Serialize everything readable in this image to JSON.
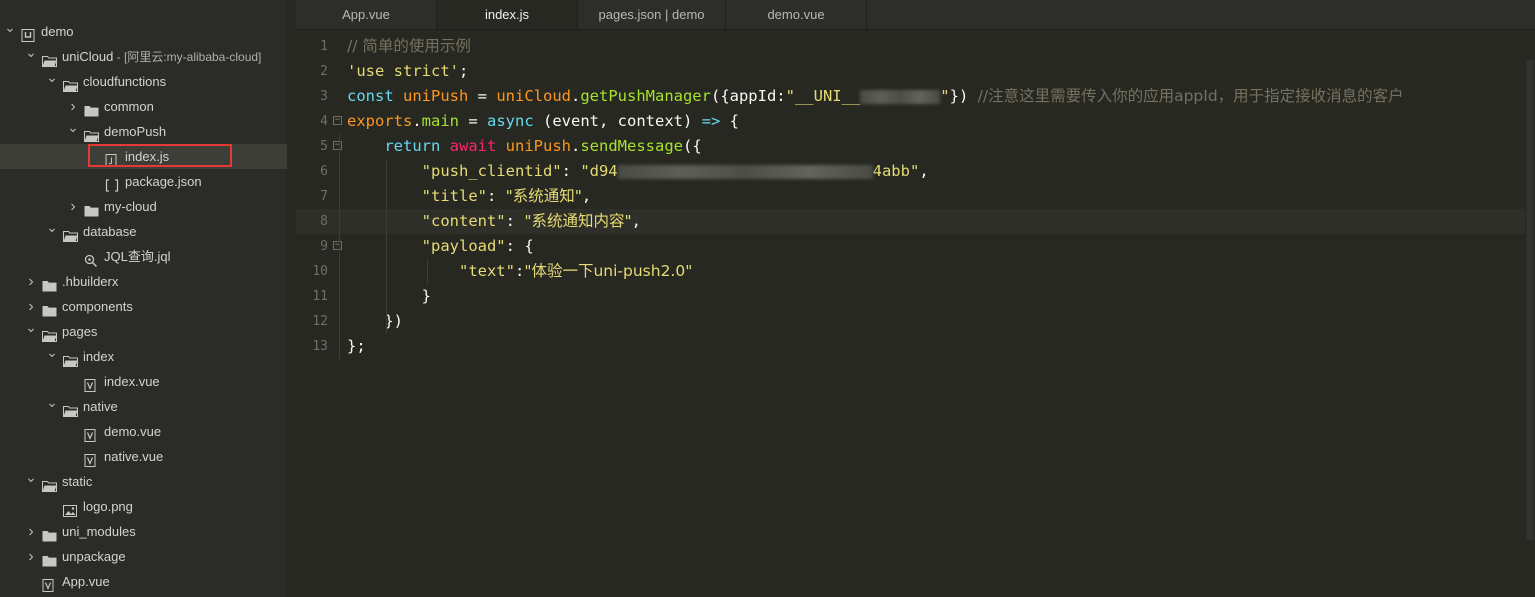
{
  "explorer": {
    "items": [
      {
        "label": "demo",
        "depth": 0,
        "chevron": "down",
        "icon": "project-icon"
      },
      {
        "label": "uniCloud",
        "suffix": " - [阿里云:my-alibaba-cloud]",
        "depth": 1,
        "chevron": "down",
        "icon": "folder-open-icon"
      },
      {
        "label": "cloudfunctions",
        "depth": 2,
        "chevron": "down",
        "icon": "folder-open-icon"
      },
      {
        "label": "common",
        "depth": 3,
        "chevron": "right",
        "icon": "folder-icon"
      },
      {
        "label": "demoPush",
        "depth": 3,
        "chevron": "down",
        "icon": "folder-open-icon"
      },
      {
        "label": "index.js",
        "depth": 4,
        "chevron": "",
        "icon": "js-file-icon",
        "selected": true
      },
      {
        "label": "package.json",
        "depth": 4,
        "chevron": "",
        "icon": "json-file-icon"
      },
      {
        "label": "my-cloud",
        "depth": 3,
        "chevron": "right",
        "icon": "folder-icon"
      },
      {
        "label": "database",
        "depth": 2,
        "chevron": "down",
        "icon": "folder-open-icon"
      },
      {
        "label": "JQL查询.jql",
        "depth": 3,
        "chevron": "",
        "icon": "jql-file-icon"
      },
      {
        "label": ".hbuilderx",
        "depth": 1,
        "chevron": "right",
        "icon": "folder-icon"
      },
      {
        "label": "components",
        "depth": 1,
        "chevron": "right",
        "icon": "folder-icon"
      },
      {
        "label": "pages",
        "depth": 1,
        "chevron": "down",
        "icon": "folder-open-icon"
      },
      {
        "label": "index",
        "depth": 2,
        "chevron": "down",
        "icon": "folder-open-icon"
      },
      {
        "label": "index.vue",
        "depth": 3,
        "chevron": "",
        "icon": "vue-file-icon"
      },
      {
        "label": "native",
        "depth": 2,
        "chevron": "down",
        "icon": "folder-open-icon"
      },
      {
        "label": "demo.vue",
        "depth": 3,
        "chevron": "",
        "icon": "vue-file-icon"
      },
      {
        "label": "native.vue",
        "depth": 3,
        "chevron": "",
        "icon": "vue-file-icon"
      },
      {
        "label": "static",
        "depth": 1,
        "chevron": "down",
        "icon": "folder-open-icon"
      },
      {
        "label": "logo.png",
        "depth": 2,
        "chevron": "",
        "icon": "image-file-icon"
      },
      {
        "label": "uni_modules",
        "depth": 1,
        "chevron": "right",
        "icon": "folder-icon"
      },
      {
        "label": "unpackage",
        "depth": 1,
        "chevron": "right",
        "icon": "folder-icon"
      },
      {
        "label": "App.vue",
        "depth": 1,
        "chevron": "",
        "icon": "vue-file-icon"
      }
    ]
  },
  "tabs": [
    {
      "label": "App.vue",
      "active": false
    },
    {
      "label": "index.js",
      "active": true
    },
    {
      "label": "pages.json | demo",
      "active": false
    },
    {
      "label": "demo.vue",
      "active": false
    }
  ],
  "editor": {
    "current_line": 8,
    "lines": [
      {
        "num": "1",
        "fold": false,
        "tokens": [
          [
            "c-comment c-zh",
            "// 简单的使用示例"
          ]
        ]
      },
      {
        "num": "2",
        "fold": false,
        "tokens": [
          [
            "c-str",
            "'use strict'"
          ],
          [
            "c-plain",
            ";"
          ]
        ]
      },
      {
        "num": "3",
        "fold": false,
        "tokens": [
          [
            "c-kw",
            "const "
          ],
          [
            "c-var",
            "uniPush"
          ],
          [
            "c-plain",
            " = "
          ],
          [
            "c-var",
            "uniCloud"
          ],
          [
            "c-plain",
            "."
          ],
          [
            "c-fn",
            "getPushManager"
          ],
          [
            "c-plain",
            "({appId:"
          ],
          [
            "c-str",
            "\"__UNI__"
          ],
          [
            "blur",
            "80"
          ],
          [
            "c-str",
            "\""
          ],
          [
            "c-plain",
            "}) "
          ],
          [
            "c-comment c-zh",
            "//注意这里需要传入你的应用appId，用于指定接收消息的客户"
          ]
        ]
      },
      {
        "num": "4",
        "fold": true,
        "tokens": [
          [
            "c-var",
            "exports"
          ],
          [
            "c-plain",
            "."
          ],
          [
            "c-fn",
            "main"
          ],
          [
            "c-plain",
            " = "
          ],
          [
            "c-kw",
            "async"
          ],
          [
            "c-plain",
            " (event, context) "
          ],
          [
            "c-kw",
            "=>"
          ],
          [
            "c-plain",
            " {"
          ]
        ]
      },
      {
        "num": "5",
        "fold": true,
        "tokens": [
          [
            "c-plain",
            "    "
          ],
          [
            "c-kw",
            "return "
          ],
          [
            "c-op",
            "await "
          ],
          [
            "c-var",
            "uniPush"
          ],
          [
            "c-plain",
            "."
          ],
          [
            "c-fn",
            "sendMessage"
          ],
          [
            "c-plain",
            "({"
          ]
        ]
      },
      {
        "num": "6",
        "fold": false,
        "tokens": [
          [
            "c-plain",
            "        "
          ],
          [
            "c-str",
            "\"push_clientid\""
          ],
          [
            "c-plain",
            ": "
          ],
          [
            "c-str",
            "\"d94"
          ],
          [
            "blur",
            "255"
          ],
          [
            "c-str",
            "4abb\""
          ],
          [
            "c-plain",
            ","
          ]
        ]
      },
      {
        "num": "7",
        "fold": false,
        "tokens": [
          [
            "c-plain",
            "        "
          ],
          [
            "c-str",
            "\"title\""
          ],
          [
            "c-plain",
            ": "
          ],
          [
            "c-str c-zh",
            "\"系统通知\""
          ],
          [
            "c-plain",
            ","
          ]
        ]
      },
      {
        "num": "8",
        "fold": false,
        "tokens": [
          [
            "c-plain",
            "        "
          ],
          [
            "c-str",
            "\"content\""
          ],
          [
            "c-plain",
            ": "
          ],
          [
            "c-str c-zh",
            "\"系统通知内容\""
          ],
          [
            "c-plain",
            ","
          ]
        ]
      },
      {
        "num": "9",
        "fold": true,
        "tokens": [
          [
            "c-plain",
            "        "
          ],
          [
            "c-str",
            "\"payload\""
          ],
          [
            "c-plain",
            ": {"
          ]
        ]
      },
      {
        "num": "10",
        "fold": false,
        "tokens": [
          [
            "c-plain",
            "            "
          ],
          [
            "c-str",
            "\"text\""
          ],
          [
            "c-plain",
            ":"
          ],
          [
            "c-str c-zh",
            "\"体验一下uni-push2.0\""
          ]
        ]
      },
      {
        "num": "11",
        "fold": false,
        "tokens": [
          [
            "c-plain",
            "        }"
          ]
        ]
      },
      {
        "num": "12",
        "fold": false,
        "tokens": [
          [
            "c-plain",
            "    })"
          ]
        ]
      },
      {
        "num": "13",
        "fold": false,
        "tokens": [
          [
            "c-plain",
            "};"
          ]
        ]
      }
    ]
  }
}
